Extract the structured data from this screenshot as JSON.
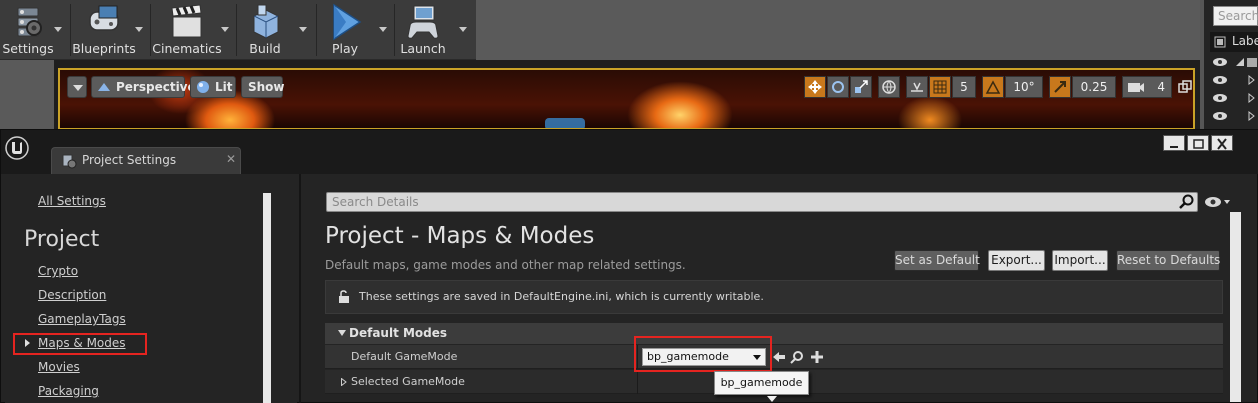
{
  "toolbar": {
    "buttons": [
      {
        "label": "Settings",
        "icon": "settings-icon"
      },
      {
        "label": "Blueprints",
        "icon": "blueprints-icon"
      },
      {
        "label": "Cinematics",
        "icon": "clapperboard-icon"
      },
      {
        "label": "Build",
        "icon": "build-icon"
      },
      {
        "label": "Play",
        "icon": "play-icon"
      },
      {
        "label": "Launch",
        "icon": "gamepad-icon"
      }
    ]
  },
  "outliner": {
    "search_placeholder": "Search",
    "column_label": "Labe"
  },
  "viewport": {
    "perspective_label": "Perspective",
    "lit_label": "Lit",
    "show_label": "Show",
    "grid_snap": "5",
    "rotation_snap": "10°",
    "scale_snap": "0.25",
    "camera_speed": "4"
  },
  "window": {
    "tab_title": "Project Settings",
    "close_glyph": "✕"
  },
  "nav": {
    "all_settings": "All Settings",
    "section": "Project",
    "items": [
      "Crypto",
      "Description",
      "GameplayTags",
      "Maps & Modes",
      "Movies",
      "Packaging"
    ],
    "selected": "Maps & Modes"
  },
  "details": {
    "search_placeholder": "Search Details",
    "title": "Project - Maps & Modes",
    "subtitle": "Default maps, game modes and other map related settings.",
    "buttons": {
      "set_default": "Set as Default",
      "export": "Export...",
      "import": "Import...",
      "reset": "Reset to Defaults"
    },
    "info_text": "These settings are saved in DefaultEngine.ini, which is currently writable.",
    "category": "Default Modes",
    "properties": [
      {
        "label": "Default GameMode",
        "value": "bp_gamemode"
      },
      {
        "label": "Selected GameMode"
      }
    ],
    "tooltip": "bp_gamemode"
  },
  "colors": {
    "highlight": "#e52420",
    "viewport_border": "#c9a227",
    "snap_orange": "#c8781c"
  }
}
